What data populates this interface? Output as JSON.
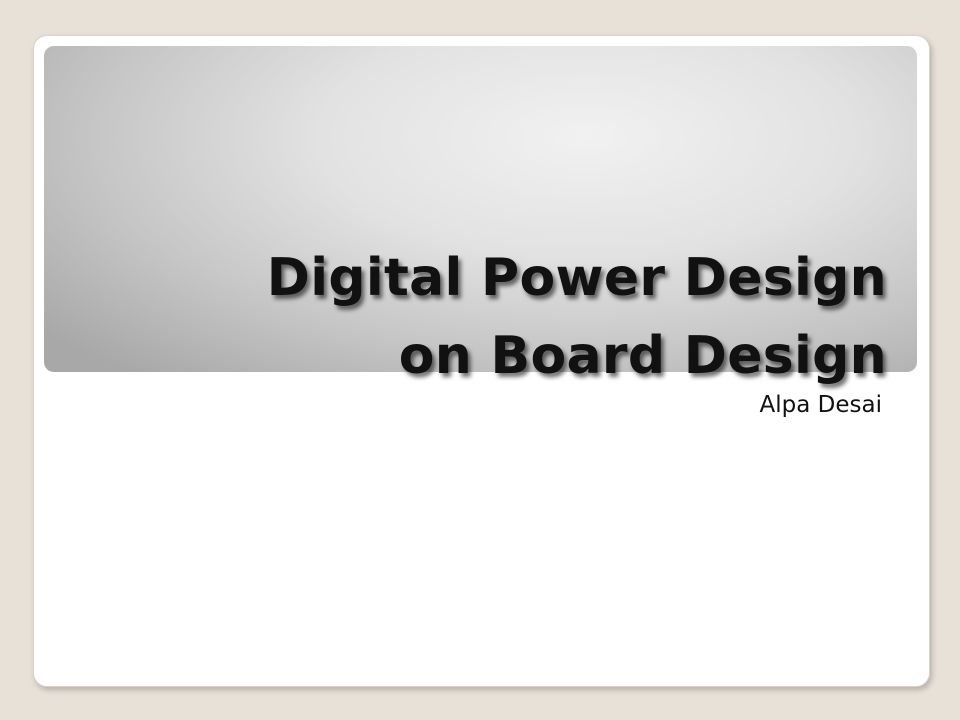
{
  "slide": {
    "title_lines": [
      "Digital Power Design",
      "on Board Design"
    ],
    "subtitle": "Alpa Desai"
  }
}
